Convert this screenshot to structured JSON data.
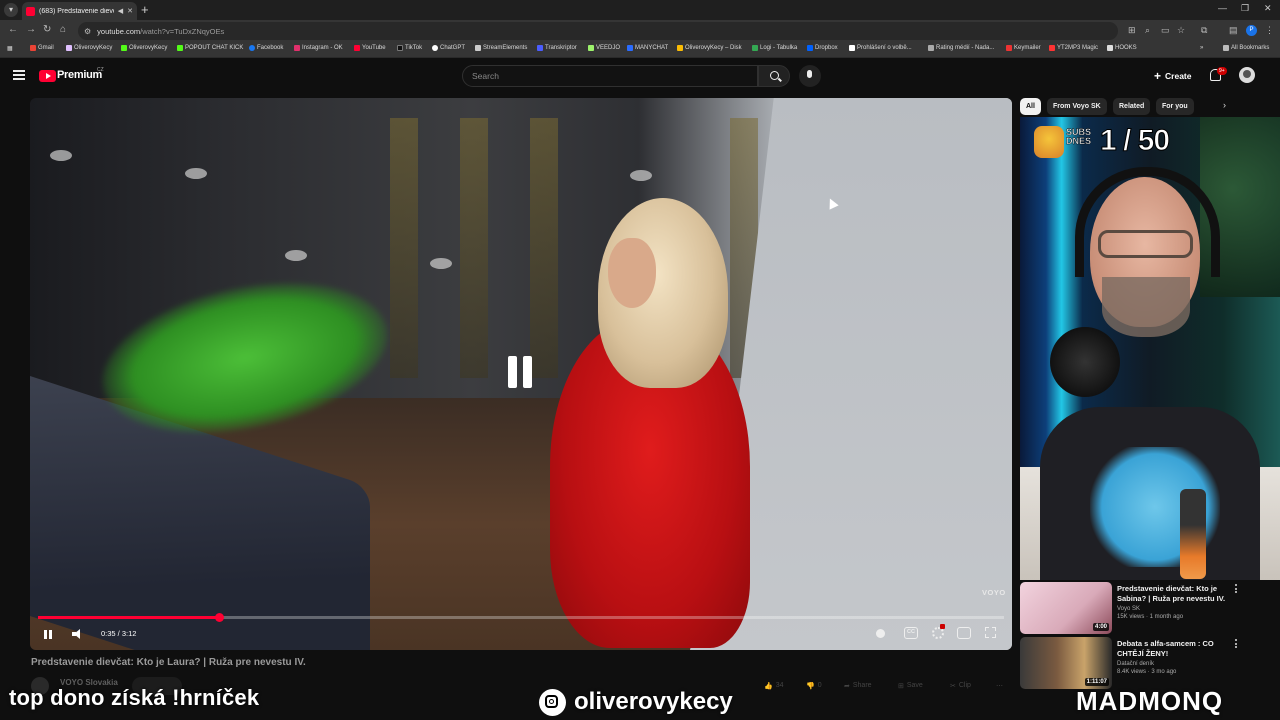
{
  "browser": {
    "tab_title": "(683) Predstavenie dievčat: Kto je Laura? | Ruža pre nevestu IV.",
    "tab_icons": {
      "audio": "speaker-icon",
      "close": "close-icon"
    },
    "new_tab": "+",
    "url_host": "youtube.com",
    "url_rest": "/watch?v=TuDxZNqyOEs",
    "profile_letter": "P",
    "bookmarks": [
      "Gmail",
      "OliverovyKecy",
      "OliverovyKecy",
      "POPOUT CHAT KICK",
      "Facebook",
      "Instagram - OK",
      "YouTube",
      "TikTok",
      "ChatGPT",
      "StreamElements",
      "Transkriptor",
      "VEEDJO",
      "MANYCHAT",
      "OliverovyKecy – Disk",
      "Logi - Tabulka",
      "Dropbox",
      "Prohlášení o volbě...",
      "Rating médií - Nada...",
      "Keymailer",
      "YT2MP3 Magic",
      "HOOKS"
    ],
    "all_bookmarks": "All Bookmarks"
  },
  "header": {
    "brand": "Premium",
    "country": "CZ",
    "search_placeholder": "Search",
    "create_label": "Create",
    "notif_count": "9+"
  },
  "player": {
    "time": "0:35 / 3:12",
    "progress": 0.187,
    "watermark": "VOYO",
    "state": "paused"
  },
  "video": {
    "title": "Predstavenie dievčat: Kto je Laura? | Ruža pre nevestu IV.",
    "channel": "VOYO Slovakia",
    "likes": "34",
    "dislikes": "0",
    "share": "Share",
    "save": "Save",
    "clip": "Clip"
  },
  "chips": [
    "All",
    "From Voyo SK",
    "Related",
    "For you"
  ],
  "overlay": {
    "subs_label": "SUBS DNES",
    "subs_count": "1 / 50",
    "left_text": "top dono získá !hrníček",
    "instagram": "oliverovykecy",
    "right_text": "MADMONQ"
  },
  "related": [
    {
      "title": "Predstavenie dievčat: Kto je Sabina? | Ruža pre nevestu IV.",
      "channel": "Voyo SK",
      "meta": "15K views · 1 month ago",
      "duration": "4:00"
    },
    {
      "title": "Debata s alfa-samcem : CO CHTĚJÍ ŽENY!",
      "channel": "Datační deník",
      "meta": "8.4K views · 3 mo ago",
      "duration": "1:11:07"
    }
  ]
}
